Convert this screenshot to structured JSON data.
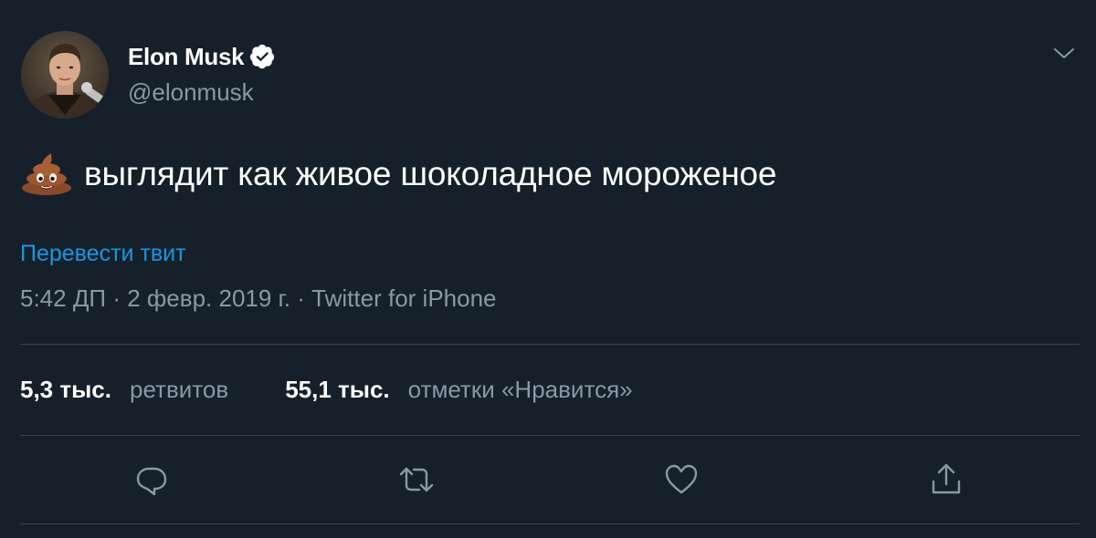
{
  "author": {
    "name": "Elon Musk",
    "handle": "@elonmusk",
    "verified": true
  },
  "tweet": {
    "emoji": "poop-emoji",
    "text": "выглядит как живое шоколадное мороженое",
    "translate_link": "Перевести твит",
    "meta": "5:42 ДП · 2 февр. 2019 г. · Twitter for iPhone"
  },
  "stats": {
    "retweets_count": "5,3 тыс.",
    "retweets_label": "ретвитов",
    "likes_count": "55,1 тыс.",
    "likes_label": "отметки «Нравится»"
  },
  "actions": [
    "reply-icon",
    "retweet-icon",
    "like-icon",
    "share-icon"
  ],
  "colors": {
    "background": "#15202b",
    "accent": "#1b95e0",
    "secondary_text": "#8899a6",
    "divider": "#38444d"
  }
}
